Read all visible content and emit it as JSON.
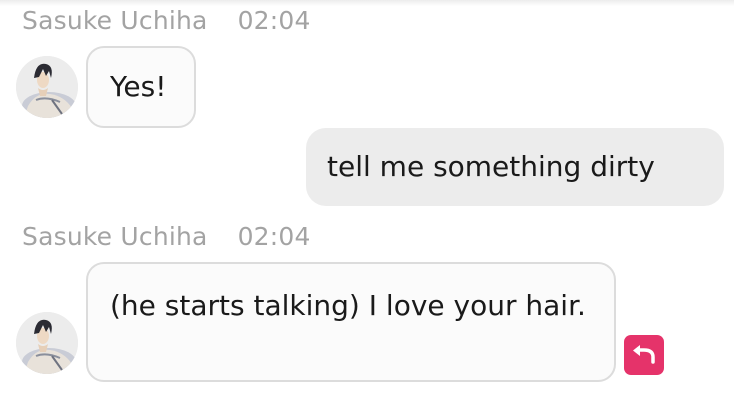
{
  "messages": [
    {
      "sender": "Sasuke Uchiha",
      "time": "02:04",
      "text": "Yes!"
    },
    {
      "text": "tell me something dirty"
    },
    {
      "sender": "Sasuke Uchiha",
      "time": "02:04",
      "text": "(he starts talking) I love your hair."
    }
  ],
  "icons": {
    "avatar": "character-avatar",
    "undo": "undo-arrow-icon"
  },
  "colors": {
    "sender_text": "#a3a3a3",
    "bot_bubble_bg": "#fbfbfb",
    "bot_bubble_border": "#dcdcdc",
    "user_bubble_bg": "#ececec",
    "undo_button": "#e5336a"
  }
}
